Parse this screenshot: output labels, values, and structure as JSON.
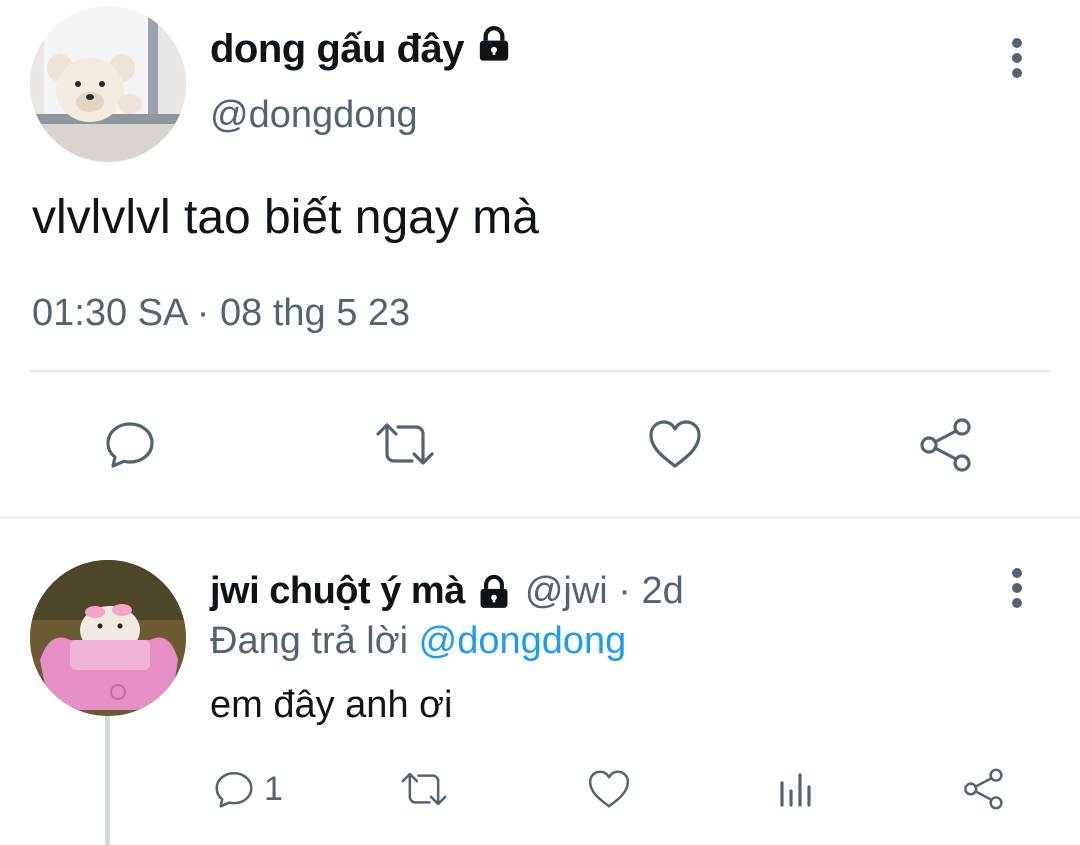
{
  "tweet": {
    "display_name": "dong gấu đây",
    "handle": "@dongdong",
    "text": "vlvlvlvl tao biết ngay mà",
    "timestamp": "01:30 SA · 08 thg 5 23"
  },
  "reply": {
    "display_name": "jwi chuột ý mà",
    "handle": "@jwi · 2d",
    "replying_prefix": "Đang trả lời",
    "replying_mention": "@dongdong",
    "text": "em đây anh ơi",
    "reply_count": "1"
  },
  "icons": {
    "lock": "lock-icon",
    "more": "more-vertical-icon",
    "reply": "comment-icon",
    "retweet": "retweet-icon",
    "like": "heart-icon",
    "views": "bar-chart-icon",
    "share": "share-icon"
  },
  "colors": {
    "text": "#0f1419",
    "secondary": "#536471",
    "accent": "#1d9bf0",
    "divider": "#e7eaec"
  }
}
